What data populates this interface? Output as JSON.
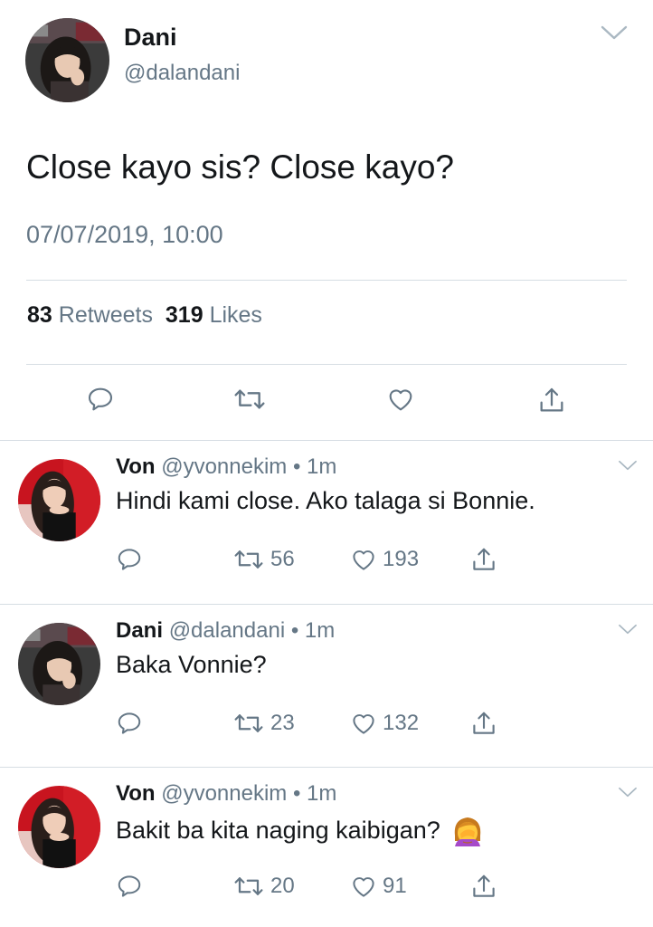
{
  "main_tweet": {
    "name": "Dani",
    "handle": "@dalandani",
    "text": "Close kayo sis? Close kayo?",
    "timestamp": "07/07/2019, 10:00",
    "retweets_count": "83",
    "retweets_label": "Retweets",
    "likes_count": "319",
    "likes_label": "Likes",
    "actions": [
      "reply-icon",
      "retweet-icon",
      "like-icon",
      "share-icon"
    ]
  },
  "replies": [
    {
      "name": "Von",
      "meta": "@yvonnekim • 1m",
      "text": "Hindi kami close. Ako talaga si Bonnie.",
      "retweets": "56",
      "likes": "193"
    },
    {
      "name": "Dani",
      "meta": "@dalandani • 1m",
      "text": "Baka Vonnie?",
      "retweets": "23",
      "likes": "132"
    },
    {
      "name": "Von",
      "meta": "@yvonnekim • 1m",
      "text": "Bakit ba kita naging kaibigan?",
      "emoji": "woman-facepalming-emoji",
      "retweets": "20",
      "likes": "91"
    }
  ],
  "colors": {
    "text_primary": "#14171a",
    "text_secondary": "#657786",
    "divider": "#d6dde3"
  }
}
